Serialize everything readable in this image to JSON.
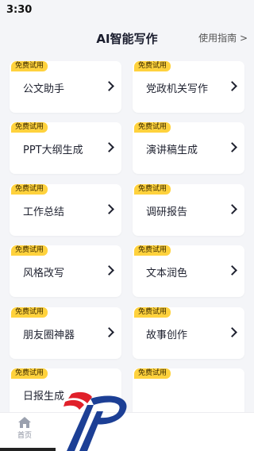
{
  "status": {
    "time": "3:30"
  },
  "header": {
    "title": "AI智能写作",
    "guide_link": "使用指南 >"
  },
  "badge_label": "免费试用",
  "cards": [
    {
      "label": "公文助手"
    },
    {
      "label": "党政机关写作"
    },
    {
      "label": "PPT大纲生成"
    },
    {
      "label": "演讲稿生成"
    },
    {
      "label": "工作总结"
    },
    {
      "label": "调研报告"
    },
    {
      "label": "风格改写"
    },
    {
      "label": "文本润色"
    },
    {
      "label": "朋友圈神器"
    },
    {
      "label": "故事创作"
    },
    {
      "label": "日报生成"
    },
    {
      "label": ""
    }
  ],
  "bottom_nav": {
    "home_label": "首页"
  },
  "colors": {
    "badge": "#ffd23d",
    "background": "#f4f5f8",
    "logo_blue": "#1c3f95",
    "logo_red": "#e0202a"
  },
  "icons": [
    "chevron-right-icon",
    "home-icon",
    "app-logo-icon"
  ]
}
